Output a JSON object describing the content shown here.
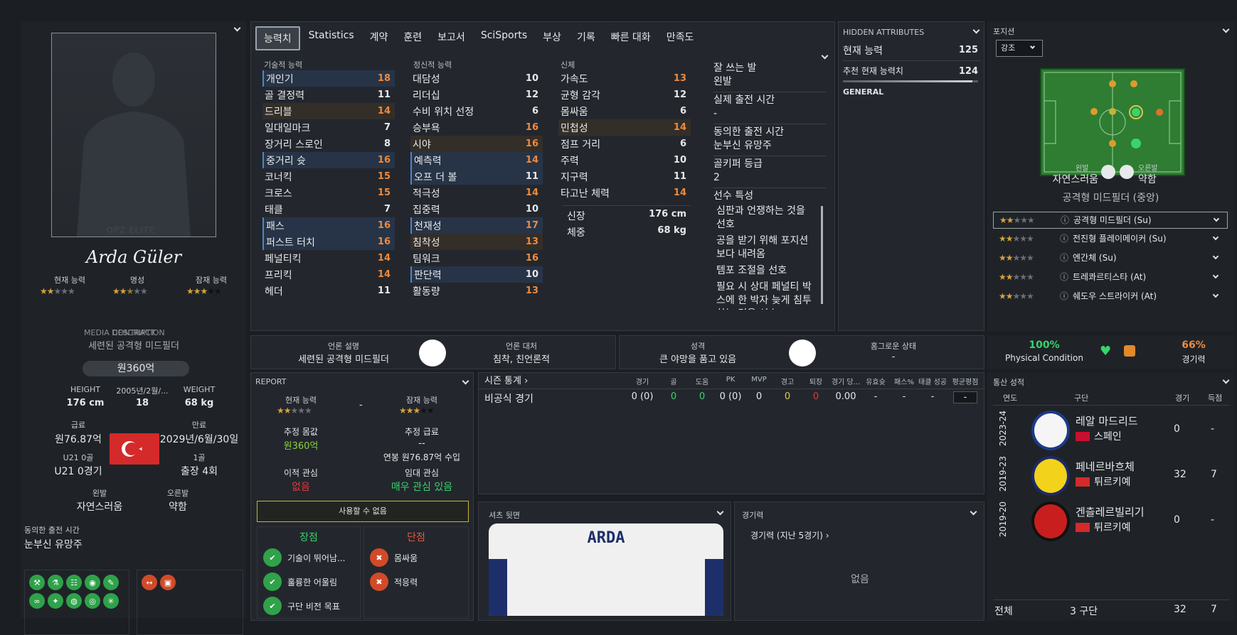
{
  "colors": {
    "accent_orange": "#f08a3c",
    "green": "#39d36b",
    "red": "#e03a3a",
    "star": "#d8a23a",
    "pitch": "#2e7d32"
  },
  "profile": {
    "name": "Arda Güler",
    "labels": {
      "current": "현재 능력",
      "reputation": "명성",
      "potential": "잠재 능력"
    },
    "current_stars": 2,
    "reputation_stars": 2.5,
    "potential_stars": 3,
    "watermark": "OPZ ELITE",
    "overlay1": "MEDIA DESCRIPTION",
    "overlay2": "CONTRACT",
    "desc": "세련된 공격형 미드필더",
    "value": "원360억",
    "height_label": "HEIGHT",
    "height": "176 cm",
    "dob_label": "2005년/2월/...",
    "age": "18",
    "weight_label": "WEIGHT",
    "weight": "68 kg",
    "wage_label": "급료",
    "wage": "원76.87억",
    "expiry_label": "만료",
    "expiry": "2029년/6월/30일",
    "u21_label": "U21 0골",
    "u21": "U21 0경기",
    "goals_label": "1골",
    "apps": "출장 4회",
    "left_label": "왼발",
    "left": "자연스러움",
    "right_label": "오른발",
    "right": "약함",
    "playtime_label": "동의한 출전 시간",
    "playtime": "눈부신 유망주"
  },
  "tabs": [
    "능력치",
    "Statistics",
    "계약",
    "훈련",
    "보고서",
    "SciSports",
    "부상",
    "기록",
    "빠른 대화",
    "만족도"
  ],
  "attrs": {
    "tech_title": "기술적 능력",
    "mental_title": "정신적 능력",
    "phys_title": "신체",
    "tech": [
      [
        "개인기",
        "18"
      ],
      [
        "골 결정력",
        "11"
      ],
      [
        "드리블",
        "14"
      ],
      [
        "일대일마크",
        "7"
      ],
      [
        "장거리 스로인",
        "8"
      ],
      [
        "중거리 슛",
        "16"
      ],
      [
        "코너킥",
        "15"
      ],
      [
        "크로스",
        "15"
      ],
      [
        "태클",
        "7"
      ],
      [
        "패스",
        "16"
      ],
      [
        "퍼스트 터치",
        "16"
      ],
      [
        "페널티킥",
        "14"
      ],
      [
        "프리킥",
        "14"
      ],
      [
        "헤더",
        "11"
      ]
    ],
    "mental": [
      [
        "대담성",
        "10"
      ],
      [
        "리더십",
        "12"
      ],
      [
        "수비 위치 선정",
        "6"
      ],
      [
        "승부욕",
        "16"
      ],
      [
        "시야",
        "16"
      ],
      [
        "예측력",
        "14"
      ],
      [
        "오프 더 볼",
        "11"
      ],
      [
        "적극성",
        "14"
      ],
      [
        "집중력",
        "10"
      ],
      [
        "천재성",
        "17"
      ],
      [
        "침착성",
        "13"
      ],
      [
        "팀워크",
        "16"
      ],
      [
        "판단력",
        "10"
      ],
      [
        "활동량",
        "13"
      ]
    ],
    "phys": [
      [
        "가속도",
        "13"
      ],
      [
        "균형 감각",
        "12"
      ],
      [
        "몸싸움",
        "6"
      ],
      [
        "민첩성",
        "14"
      ],
      [
        "점프 거리",
        "6"
      ],
      [
        "주력",
        "10"
      ],
      [
        "지구력",
        "11"
      ],
      [
        "타고난 체력",
        "14"
      ]
    ],
    "height_label": "신장",
    "height": "176 cm",
    "weight_label": "체중",
    "weight": "68 kg"
  },
  "side_info": {
    "foot_label": "잘 쓰는 발",
    "foot": "왼발",
    "actual_label": "실제 출전 시간",
    "actual": "-",
    "agreed_label": "동의한 출전 시간",
    "agreed": "눈부신 유망주",
    "gk_label": "골키퍼 등급",
    "gk": "2",
    "traits_label": "선수 특성",
    "traits": [
      "심판과 언쟁하는 것을 선호",
      "공을 받기 위해 포지션보다 내려옴",
      "템포 조절을 선호",
      "필요 시 상대 페널티 박스에 한 박자 늦게 침투하는 것을 선호"
    ]
  },
  "hidden": {
    "title": "HIDDEN ATTRIBUTES",
    "ca_label": "현재 능력",
    "ca": "125",
    "rca_label": "추천 현재 능력치",
    "rca": "124",
    "general": "GENERAL"
  },
  "position": {
    "title": "포지션",
    "select": "강조",
    "left_label": "왼발",
    "left": "자연스러움",
    "right_label": "오른발",
    "right": "약함",
    "role": "공격형 미드필더 (중앙)",
    "roles": [
      {
        "name": "공격형 미드필더 (Su)",
        "stars": 2
      },
      {
        "name": "전진형 플레이메이커 (Su)",
        "stars": 2
      },
      {
        "name": "엔간체 (Su)",
        "stars": 2
      },
      {
        "name": "트레콰르티스타 (At)",
        "stars": 2
      },
      {
        "name": "쉐도우 스트라이커 (At)",
        "stars": 2
      }
    ]
  },
  "mid_info": {
    "media_label": "언론 설명",
    "media": "세련된 공격형 미드필더",
    "handling_label": "언론 대처",
    "handling": "침착, 친언론적",
    "personality_label": "성격",
    "personality": "큰 야망을 품고 있음",
    "homesick_label": "홈그로운 상태",
    "homesick": "-"
  },
  "condition": {
    "physical": "100%",
    "physical_label": "Physical Condition",
    "sharpness": "66%",
    "sharpness_label": "경기력"
  },
  "report": {
    "title": "REPORT",
    "ca_label": "현재 능력",
    "pa_label": "잠재 능력",
    "dash": "-",
    "value_label": "추정 몸값",
    "value": "원360억",
    "wage_label": "추정 급료",
    "wage": "--",
    "wage2": "연봉 원76.87억 수입",
    "transfer_label": "이적 관심",
    "transfer": "없음",
    "loan_label": "임대 관심",
    "loan": "매우 관심 있음",
    "unavailable": "사용할 수 없음",
    "strengths": "장점",
    "weaknesses": "단점",
    "pros": [
      "기술이 뛰어남...",
      "훌륭한 어울림",
      "구단 비전 목표"
    ],
    "cons": [
      "몸싸움",
      "적응력"
    ]
  },
  "season": {
    "title": "시즌 통계",
    "headers": [
      "경기",
      "골",
      "도움",
      "PK",
      "MVP",
      "경고",
      "퇴장",
      "경기 당...",
      "유효슛",
      "패스%",
      "태클 성공",
      "평균평점"
    ],
    "row_label": "비공식 경기",
    "row": [
      "0 (0)",
      "0",
      "0",
      "0 (0)",
      "0",
      "0",
      "0",
      "0.00",
      "-",
      "-",
      "-",
      "-"
    ]
  },
  "shirt": {
    "title": "셔츠 뒷면",
    "name": "ARDA"
  },
  "form": {
    "title": "경기력",
    "sub": "경기력 (지난 5경기)",
    "empty": "없음"
  },
  "career": {
    "title": "통산 성적",
    "col_year": "연도",
    "col_club": "구단",
    "col_apps": "경기",
    "col_goals": "득점",
    "rows": [
      {
        "year": "2023-24",
        "club": "레알 마드리드",
        "country": "스페인",
        "apps": "0",
        "goals": "-"
      },
      {
        "year": "2019-23",
        "club": "페네르바흐체",
        "country": "튀르키예",
        "apps": "32",
        "goals": "7"
      },
      {
        "year": "2019-20",
        "club": "겐츨레르빌리기",
        "country": "튀르키예",
        "apps": "0",
        "goals": "-"
      }
    ],
    "total_label": "전체",
    "total_clubs": "3 구단",
    "total_apps": "32",
    "total_goals": "7"
  }
}
